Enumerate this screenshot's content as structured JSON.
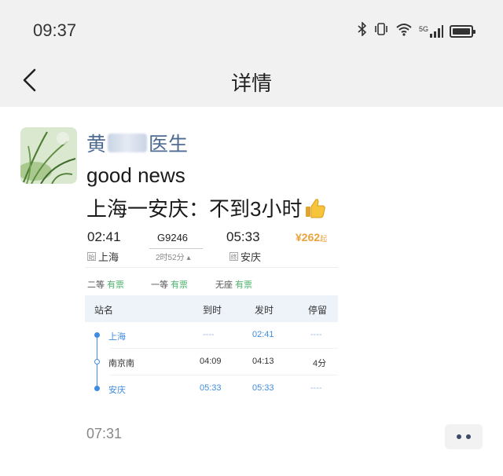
{
  "status": {
    "time": "09:37",
    "net_label": "5G"
  },
  "nav": {
    "title": "详情"
  },
  "post": {
    "sender_prefix": "黄",
    "sender_suffix": "医生",
    "line1": "good news",
    "line2": "上海一安庆：不到3小时",
    "time": "07:31"
  },
  "ticket": {
    "depart_time": "02:41",
    "depart_station": "上海",
    "depart_badge": "始",
    "train_no": "G9246",
    "duration": "2时52分 ▴",
    "arrive_time": "05:33",
    "arrive_station": "安庆",
    "arrive_badge": "终",
    "price_symbol": "¥",
    "price": "262",
    "price_suffix": "起",
    "seats": [
      {
        "class": "二等",
        "status": "有票"
      },
      {
        "class": "一等",
        "status": "有票"
      },
      {
        "class": "无座",
        "status": "有票"
      }
    ],
    "stop_headers": {
      "station": "站名",
      "arrive": "到时",
      "depart": "发时",
      "stay": "停留"
    },
    "stops": [
      {
        "station": "上海",
        "arrive": "----",
        "depart": "02:41",
        "stay": "----"
      },
      {
        "station": "南京南",
        "arrive": "04:09",
        "depart": "04:13",
        "stay": "4分"
      },
      {
        "station": "安庆",
        "arrive": "05:33",
        "depart": "05:33",
        "stay": "----"
      }
    ]
  },
  "colors": {
    "link_blue": "#3f8de0",
    "seat_green": "#4bb36b",
    "price_orange": "#e8a33c",
    "sender_blue": "#4e6b92"
  }
}
